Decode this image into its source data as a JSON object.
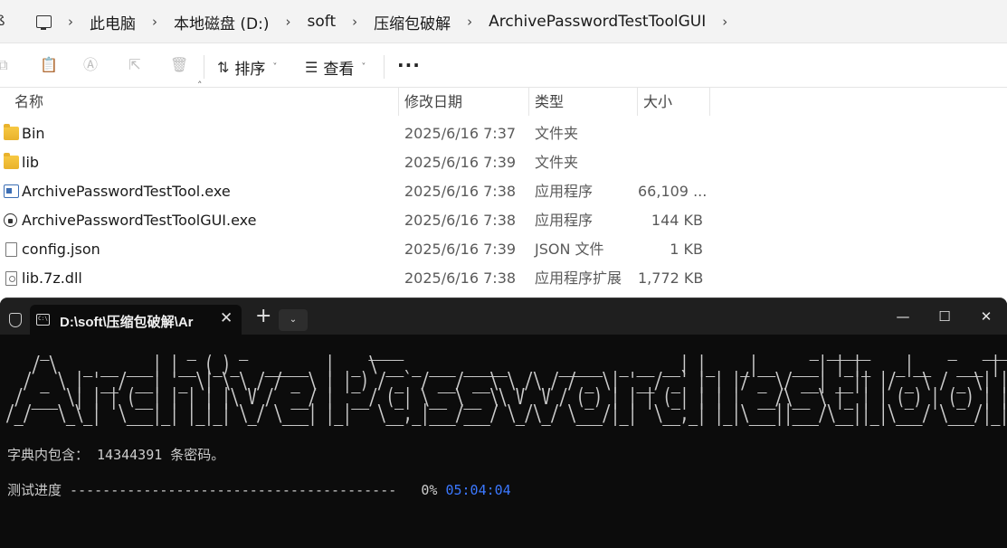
{
  "explorer": {
    "breadcrumbs": [
      "此电脑",
      "本地磁盘 (D:)",
      "soft",
      "压缩包破解",
      "ArchivePasswordTestToolGUI"
    ],
    "toolbar": {
      "sort_label": "排序",
      "view_label": "查看",
      "more_label": "···"
    },
    "columns": {
      "name": "名称",
      "date": "修改日期",
      "type": "类型",
      "size": "大小"
    },
    "files": [
      {
        "name": "Bin",
        "date": "2025/6/16 7:37",
        "type": "文件夹",
        "size": "",
        "icon": "folder-icon"
      },
      {
        "name": "lib",
        "date": "2025/6/16 7:39",
        "type": "文件夹",
        "size": "",
        "icon": "folder-icon"
      },
      {
        "name": "ArchivePasswordTestTool.exe",
        "date": "2025/6/16 7:38",
        "type": "应用程序",
        "size": "66,109 ...",
        "icon": "exe-icon"
      },
      {
        "name": "ArchivePasswordTestToolGUI.exe",
        "date": "2025/6/16 7:38",
        "type": "应用程序",
        "size": "144 KB",
        "icon": "lock-exe-icon"
      },
      {
        "name": "config.json",
        "date": "2025/6/16 7:39",
        "type": "JSON 文件",
        "size": "1 KB",
        "icon": "file-icon"
      },
      {
        "name": "lib.7z.dll",
        "date": "2025/6/16 7:38",
        "type": "应用程序扩展",
        "size": "1,772 KB",
        "icon": "dll-icon"
      }
    ]
  },
  "terminal": {
    "tab_title": "D:\\soft\\压缩包破解\\Ar",
    "banner": "    _                _     _              ____                                               _ _____         _   _____           _ \n   / \\   _ __ ___| |__ (_)_   _____  |  _ \\ __ _ ___ _____      _____  _ __ __| |_   _|__  ___| |_|_   _|__   ___ | |\n  / _ \\ | '__/ __| '_ \\| \\ \\ / / _ \\ | |_) / _` / __/ __\\ \\ /\\ / / _ \\| '__/ _` | | |/ _ \\/ __| __|| |/ _ \\ / _ \\| |\n / ___ \\| | | (__| | | | |\\ V /  __/ |  __/ (_| \\__ \\__ \\\\ V  V / (_) | | | (_| | | |  __/\\__ \\ |_ | | (_) | (_) | |\n/_/   \\_\\_|  \\___|_| |_|_| \\_/ \\___| |_|   \\__,_|___/___/ \\_/\\_/ \\___/|_|  \\__,_| |_|\\___||___/\\__||_|\\___/ \\___/|_|",
    "dict_line": "字典内包含： 14344391 条密码。",
    "progress_label": "测试进度",
    "progress_bar": "----------------------------------------",
    "progress_percent": "0%",
    "progress_time": "05:04:04",
    "progress_fraction": 0.0
  },
  "colors": {
    "terminal_bg": "#0c0c0c",
    "terminal_text": "#cccccc",
    "time_accent": "#3b78ff",
    "folder": "#f8c943"
  }
}
